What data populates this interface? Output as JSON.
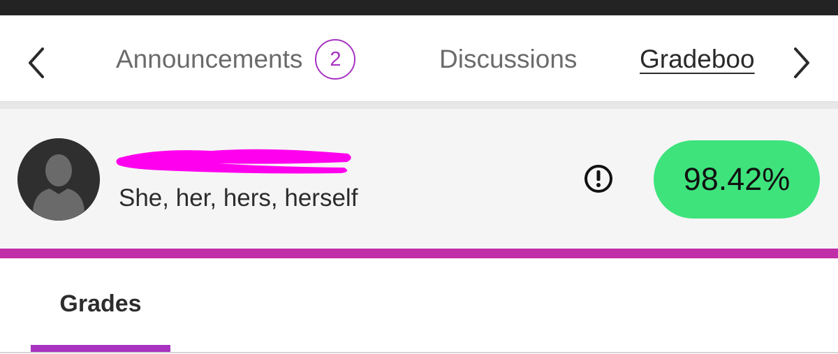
{
  "tabs": {
    "items": [
      {
        "label": "Announcements",
        "badge": "2"
      },
      {
        "label": "Discussions"
      },
      {
        "label": "Gradeboo",
        "active": true
      }
    ]
  },
  "student": {
    "pronouns": "She, her, hers, herself",
    "overall_grade": "98.42%",
    "name_redacted": true
  },
  "sub_tabs": {
    "items": [
      {
        "label": "Grades",
        "active": true
      }
    ]
  },
  "icons": {
    "prev": "chevron-left-icon",
    "next": "chevron-right-icon",
    "alert": "exclamation-circle-icon",
    "avatar": "user-silhouette-icon"
  },
  "colors": {
    "accent": "#c12ea8",
    "badge": "#a733c0",
    "grade_pill": "#3ee37c",
    "redaction": "#ff00ee"
  }
}
